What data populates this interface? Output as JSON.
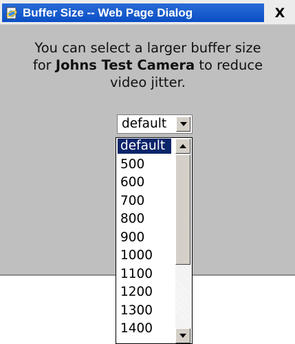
{
  "window": {
    "title": "Buffer Size -- Web Page Dialog",
    "close_label": "X"
  },
  "message": {
    "line1": "You can select a larger buffer size",
    "line2_prefix": "for ",
    "camera_name": "Johns Test Camera",
    "line2_suffix": " to reduce",
    "line3": "video jitter."
  },
  "buffer_select": {
    "selected_value": "default",
    "options": [
      "default",
      "500",
      "600",
      "700",
      "800",
      "900",
      "1000",
      "1100",
      "1200",
      "1300",
      "1400"
    ]
  },
  "colors": {
    "titlebar": "#0a4fc5",
    "dialog_bg": "#bfbfbf",
    "selection": "#0a246a"
  },
  "icons": {
    "window_icon": "ie-page-icon",
    "select_arrow": "chevron-down-icon",
    "scroll_up": "scroll-up-arrow-icon",
    "scroll_down": "scroll-down-arrow-icon"
  }
}
